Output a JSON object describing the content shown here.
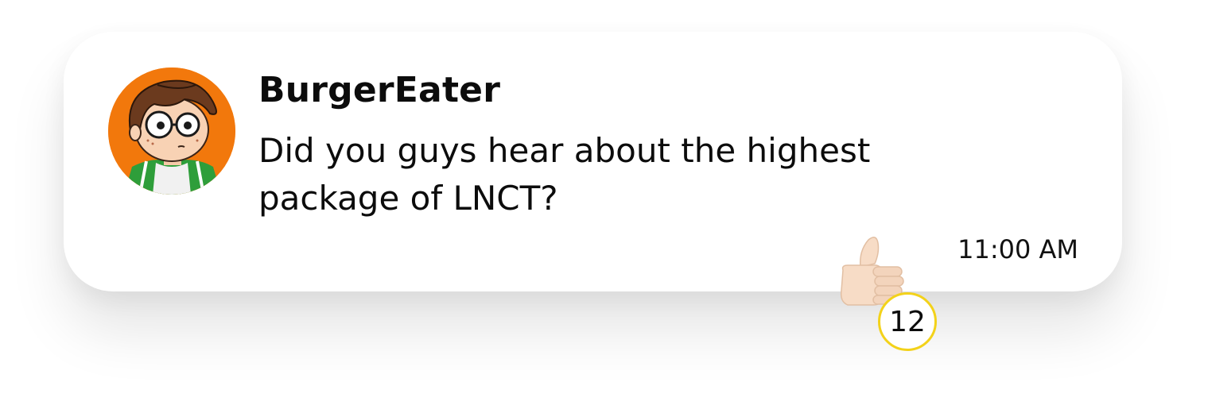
{
  "message": {
    "username": "BurgerEater",
    "text": "Did you guys hear about the highest package of LNCT?",
    "timestamp": "11:00 AM",
    "avatar_icon": "cartoon-boy-glasses-avatar",
    "reaction": {
      "icon": "thumbs-up-icon",
      "count": "12",
      "badge_border_color": "#f3d21a"
    }
  },
  "colors": {
    "avatar_background": "#f2780c",
    "card_background": "#ffffff",
    "text": "#0c0c0c"
  }
}
